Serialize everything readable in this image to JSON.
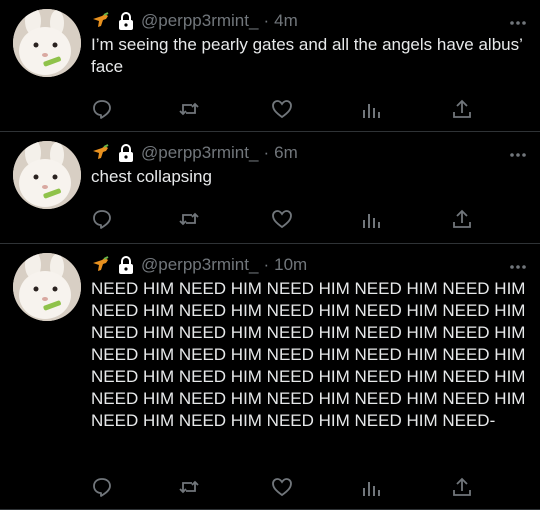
{
  "tweets": [
    {
      "handle": "@perpp3rmint_",
      "separator": "·",
      "time": "4m",
      "text": "I’m seeing the pearly gates and all the angels have albus’ face"
    },
    {
      "handle": "@perpp3rmint_",
      "separator": "·",
      "time": "6m",
      "text": "chest collapsing"
    },
    {
      "handle": "@perpp3rmint_",
      "separator": "·",
      "time": "10m",
      "text": "NEED HIM NEED HIM NEED HIM NEED HIM NEED HIM NEED HIM NEED HIM NEED HIM NEED HIM NEED HIM NEED HIM NEED HIM NEED HIM NEED HIM NEED HIM NEED HIM NEED HIM NEED HIM NEED HIM NEED HIM NEED HIM NEED HIM NEED HIM NEED HIM NEED HIM NEED HIM NEED HIM NEED HIM NEED HIM NEED HIM NEED HIM NEED HIM NEED HIM NEED HIM NEED-"
    }
  ],
  "icons": {
    "header": [
      "water-gun-emoji-icon",
      "lock-icon"
    ],
    "more": "more-options-icon",
    "actions": [
      "reply-icon",
      "retweet-icon",
      "like-icon",
      "analytics-icon",
      "share-icon"
    ]
  },
  "colors": {
    "background": "#000000",
    "text": "#e7e9ea",
    "muted": "#71767b",
    "divider": "#2f3336"
  }
}
